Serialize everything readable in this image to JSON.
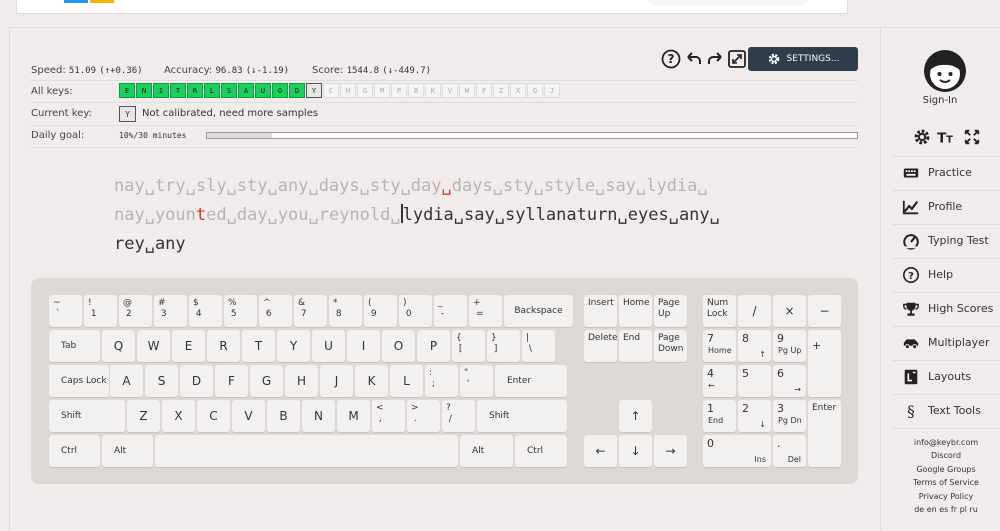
{
  "toolbar": {
    "settings_label": "SETTINGS...",
    "icons": [
      "help-icon",
      "undo-icon",
      "redo-icon",
      "fullscreen-icon",
      "gear-icon"
    ]
  },
  "stats": {
    "speed_label": "Speed:",
    "speed_value": "51.09",
    "speed_delta": "(↑+0.36)",
    "accuracy_label": "Accuracy:",
    "accuracy_value": "96.83",
    "accuracy_delta": "(↓-1.19)",
    "score_label": "Score:",
    "score_value": "1544.8",
    "score_delta": "(↓-449.7)"
  },
  "all_keys": {
    "label": "All keys:",
    "learned": [
      "E",
      "N",
      "I",
      "T",
      "R",
      "L",
      "S",
      "A",
      "U",
      "O",
      "D"
    ],
    "current": "Y",
    "locked": [
      "C",
      "H",
      "G",
      "M",
      "P",
      "B",
      "K",
      "V",
      "W",
      "F",
      "Z",
      "X",
      "Q",
      "J"
    ]
  },
  "current_key": {
    "label": "Current key:",
    "key": "Y",
    "note": "Not calibrated, need more samples"
  },
  "daily_goal": {
    "label": "Daily goal:",
    "text": "10%/30 minutes",
    "progress": 0.1
  },
  "typing": {
    "line1_done": "nay␣try␣sly␣sty␣any␣days␣sty␣day",
    "line1_err": "␣",
    "line1_done2": "days␣sty␣style␣say␣lydia␣",
    "line2_done": "nay␣youn",
    "line2_err": "t",
    "line2_done2": "ed␣day␣you␣reynold␣",
    "line2_todo": "lydia␣say␣syllanaturn␣eyes␣any␣",
    "line3_todo": "rey␣any"
  },
  "keyboard": {
    "row1": [
      {
        "top": "~",
        "bot": "`"
      },
      {
        "top": "!",
        "bot": "1"
      },
      {
        "top": "@",
        "bot": "2"
      },
      {
        "top": "#",
        "bot": "3"
      },
      {
        "top": "$",
        "bot": "4"
      },
      {
        "top": "%",
        "bot": "5"
      },
      {
        "top": "^",
        "bot": "6"
      },
      {
        "top": "&",
        "bot": "7"
      },
      {
        "top": "*",
        "bot": "8"
      },
      {
        "top": "(",
        "bot": "9"
      },
      {
        "top": ")",
        "bot": "0"
      },
      {
        "top": "_",
        "bot": "-"
      },
      {
        "top": "+",
        "bot": "="
      }
    ],
    "backspace": "Backspace",
    "tab": "Tab",
    "row2": [
      "Q",
      "W",
      "E",
      "R",
      "T",
      "Y",
      "U",
      "I",
      "O",
      "P"
    ],
    "row2_sym": [
      {
        "top": "{",
        "bot": "["
      },
      {
        "top": "}",
        "bot": "]"
      },
      {
        "top": "|",
        "bot": "\\"
      }
    ],
    "caps": "Caps Lock",
    "row3": [
      "A",
      "S",
      "D",
      "F",
      "G",
      "H",
      "J",
      "K",
      "L"
    ],
    "row3_sym": [
      {
        "top": ":",
        "bot": ";"
      },
      {
        "top": "\"",
        "bot": "'"
      }
    ],
    "enter": "Enter",
    "shift": "Shift",
    "row4": [
      "Z",
      "X",
      "C",
      "V",
      "B",
      "N",
      "M"
    ],
    "row4_sym": [
      {
        "top": "<",
        "bot": ","
      },
      {
        "top": ">",
        "bot": "."
      },
      {
        "top": "?",
        "bot": "/"
      }
    ],
    "ctrl": "Ctrl",
    "alt": "Alt",
    "nav": {
      "insert": "Insert",
      "home": "Home",
      "pgup": "Page\nUp",
      "delete": "Delete",
      "end": "End",
      "pgdn": "Page\nDown"
    },
    "arrows": {
      "up": "↑",
      "left": "←",
      "down": "↓",
      "right": "→"
    },
    "numpad": {
      "numlock": "Num\nLock",
      "div": "/",
      "mul": "×",
      "minus": "−",
      "plus": "+",
      "enter": "Enter",
      "n7": "7",
      "n7s": "Home",
      "n8": "8",
      "n8s": "↑",
      "n9": "9",
      "n9s": "Pg Up",
      "n4": "4",
      "n4s": "←",
      "n5": "5",
      "n6": "6",
      "n6s": "→",
      "n1": "1",
      "n1s": "End",
      "n2": "2",
      "n2s": "↓",
      "n3": "3",
      "n3s": "Pg Dn",
      "n0": "0",
      "n0s": "Ins",
      "dot": ".",
      "dots": "Del"
    }
  },
  "sidebar": {
    "signin": "Sign-In",
    "items": [
      {
        "label": "Practice",
        "icon": "keyboard-icon"
      },
      {
        "label": "Profile",
        "icon": "chart-icon"
      },
      {
        "label": "Typing Test",
        "icon": "speedometer-icon"
      },
      {
        "label": "Help",
        "icon": "help-icon"
      },
      {
        "label": "High Scores",
        "icon": "trophy-icon"
      },
      {
        "label": "Multiplayer",
        "icon": "car-icon"
      },
      {
        "label": "Layouts",
        "icon": "layouts-icon"
      },
      {
        "label": "Text Tools",
        "icon": "section-icon"
      }
    ],
    "footer": [
      "info@keybr.com",
      "Discord",
      "Google Groups",
      "Terms of Service",
      "Privacy Policy",
      "de en es fr pl ru"
    ]
  }
}
